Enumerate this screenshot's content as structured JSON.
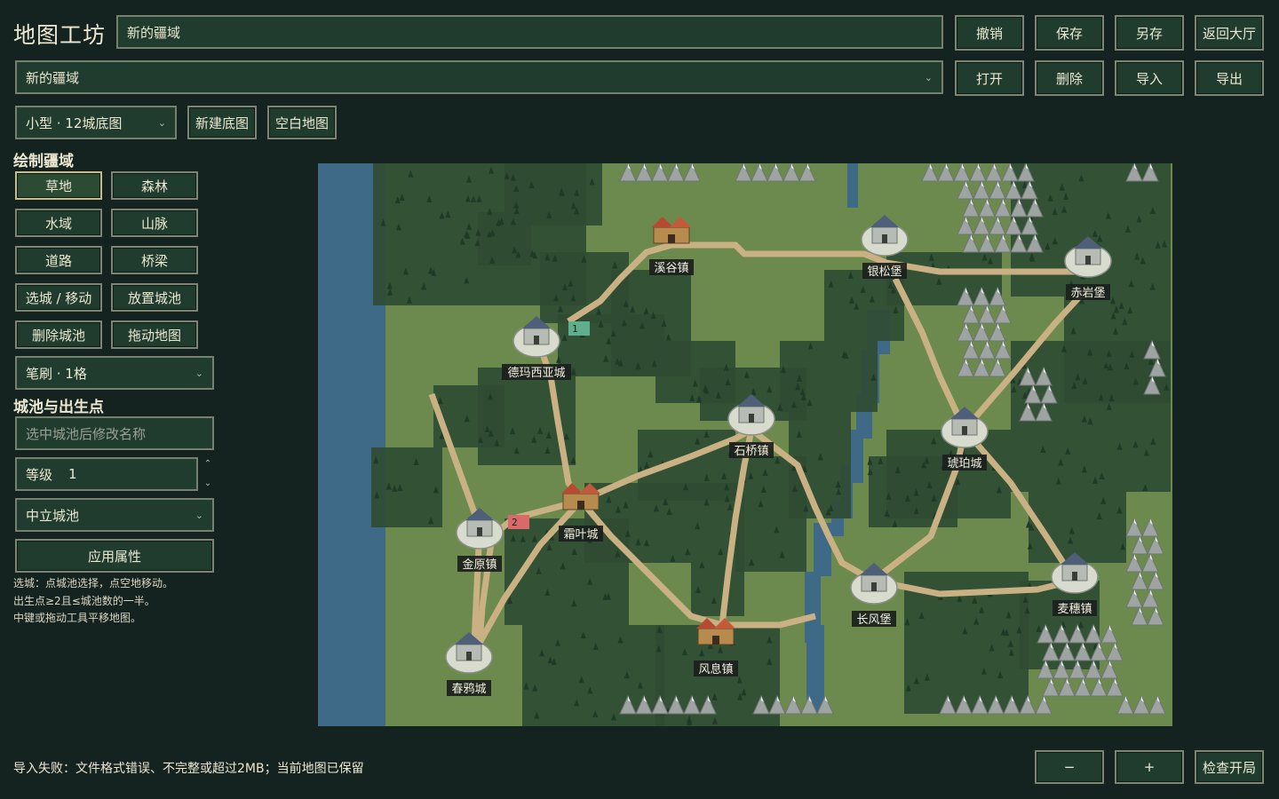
{
  "header": {
    "title": "地图工坊",
    "map_name_value": "新的疆域",
    "buttons": [
      "撤销",
      "保存",
      "另存",
      "返回大厅"
    ]
  },
  "row2": {
    "map_select_value": "新的疆域",
    "buttons": [
      "打开",
      "删除",
      "导入",
      "导出"
    ]
  },
  "row3": {
    "base_select_value": "小型 · 12城底图",
    "new_base_label": "新建底图",
    "blank_map_label": "空白地图"
  },
  "paint": {
    "section_title": "绘制疆域",
    "tools": [
      "草地",
      "森林",
      "水域",
      "山脉",
      "道路",
      "桥梁",
      "选城 / 移动",
      "放置城池",
      "删除城池",
      "拖动地图"
    ],
    "active_tool": "草地",
    "brush_value": "笔刷 · 1格"
  },
  "city": {
    "section_title": "城池与出生点",
    "name_placeholder": "选中城池后修改名称",
    "level_label": "等级",
    "level_value": "1",
    "faction_value": "中立城池",
    "apply_label": "应用属性"
  },
  "hints": [
    "选城：点城池选择，点空地移动。",
    "出生点≥2且≤城池数的一半。",
    "中键或拖动工具平移地图。"
  ],
  "status_text": "导入失败：文件格式错误、不完整或超过2MB；当前地图已保留",
  "bottom": {
    "zoom_out": "−",
    "zoom_in": "+",
    "check_label": "检查开局"
  },
  "map": {
    "colors": {
      "grass": "#6c8a4d",
      "forest": "#2f4c33",
      "water": "#3e6a88",
      "mountain": "#9ea4a2",
      "road": "#c9b184",
      "spawn1": "#5fae8e",
      "spawn2": "#d86a6a"
    },
    "cities": [
      {
        "name": "溪谷镇",
        "type": "town"
      },
      {
        "name": "银松堡",
        "type": "castle"
      },
      {
        "name": "赤岩堡",
        "type": "castle"
      },
      {
        "name": "德玛西亚城",
        "type": "castle"
      },
      {
        "name": "石桥镇",
        "type": "castle"
      },
      {
        "name": "琥珀城",
        "type": "castle"
      },
      {
        "name": "霜叶城",
        "type": "town"
      },
      {
        "name": "金原镇",
        "type": "castle"
      },
      {
        "name": "长风堡",
        "type": "castle"
      },
      {
        "name": "麦穗镇",
        "type": "castle"
      },
      {
        "name": "风息镇",
        "type": "town"
      },
      {
        "name": "春鸦城",
        "type": "castle"
      }
    ],
    "spawns": [
      {
        "label": "1"
      },
      {
        "label": "2"
      }
    ]
  }
}
